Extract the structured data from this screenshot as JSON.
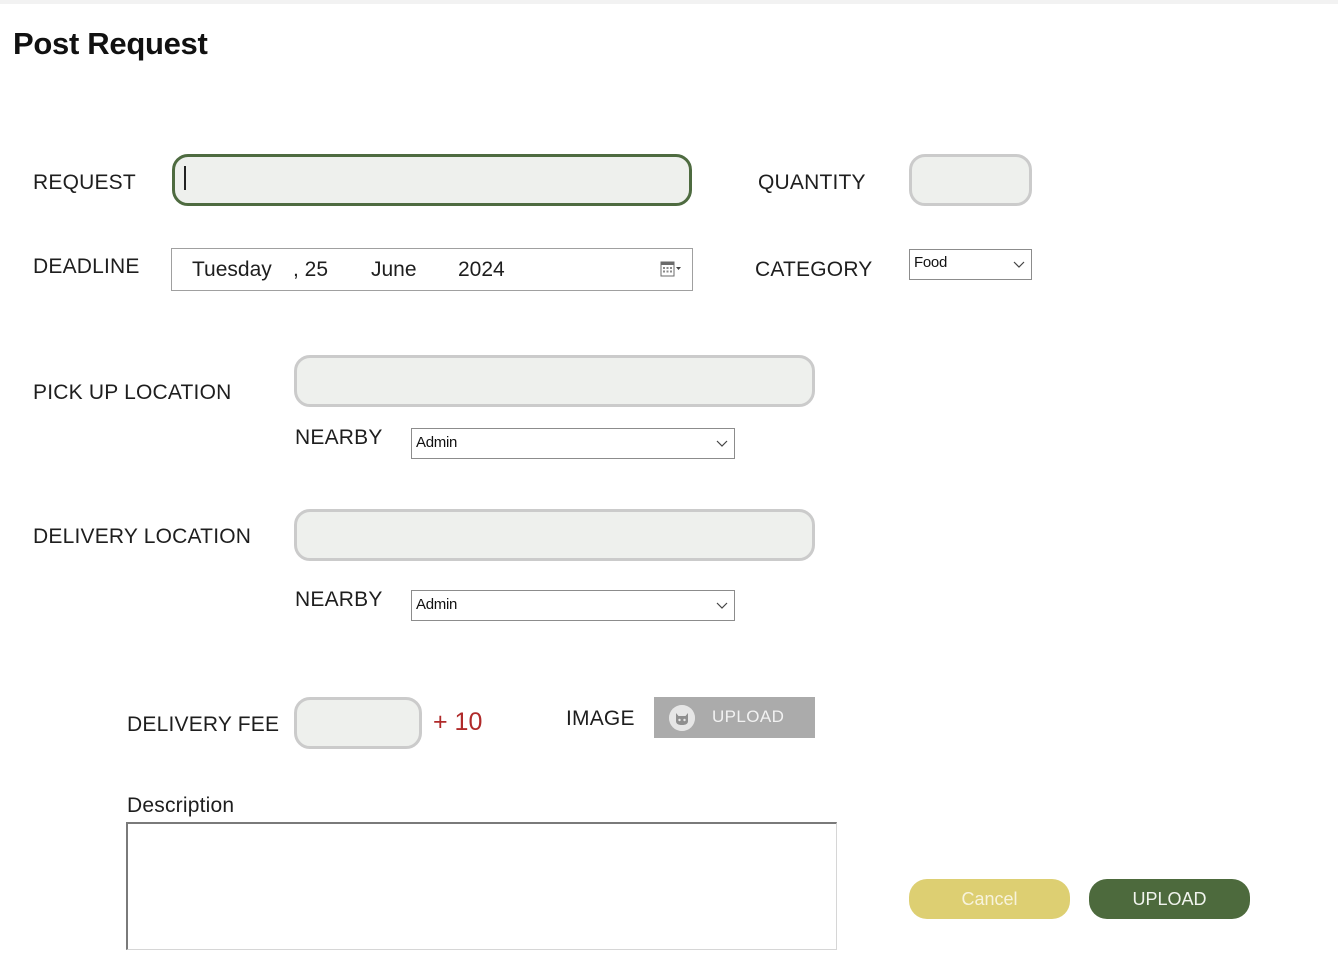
{
  "page": {
    "title": "Post Request"
  },
  "form": {
    "request_label": "REQUEST",
    "request_value": "",
    "quantity_label": "QUANTITY",
    "quantity_value": "",
    "deadline_label": "DEADLINE",
    "deadline": {
      "weekday": "Tuesday",
      "day": ", 25",
      "month": "June",
      "year": "2024"
    },
    "category_label": "CATEGORY",
    "category_value": "Food",
    "pickup_label": "PICK UP LOCATION",
    "pickup_value": "",
    "pickup_nearby_label": "NEARBY",
    "pickup_nearby_value": "Admin",
    "delivery_label": "DELIVERY LOCATION",
    "delivery_value": "",
    "delivery_nearby_label": "NEARBY",
    "delivery_nearby_value": "Admin",
    "fee_label": "DELIVERY FEE",
    "fee_value": "",
    "fee_addon": "+ 10",
    "image_label": "IMAGE",
    "image_button_label": "UPLOAD",
    "description_label": "Description",
    "description_value": ""
  },
  "actions": {
    "cancel_label": "Cancel",
    "upload_label": "UPLOAD"
  },
  "colors": {
    "accent": "#4d6a3d",
    "cancel": "#ddcf72",
    "field_bg": "#eef0ed",
    "fee_addon": "#b02a2a"
  },
  "icons": {
    "calendar": "calendar-icon",
    "chevron": "chevron-down-icon",
    "upload": "cat-avatar-icon"
  }
}
